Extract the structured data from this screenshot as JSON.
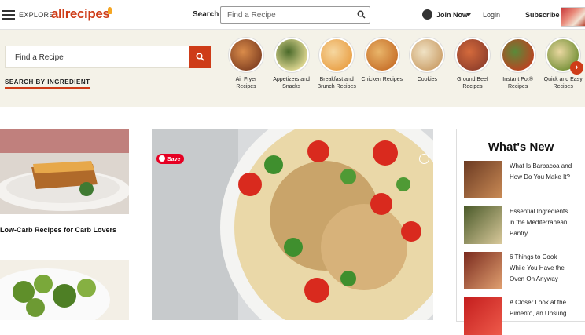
{
  "header": {
    "explore_label": "EXPLORE",
    "logo_text": "allrecipes",
    "search_label": "Search",
    "search_placeholder": "Find a Recipe",
    "join_label": "Join Now",
    "login_label": "Login",
    "subscribe_label": "Subscribe"
  },
  "band": {
    "find_placeholder": "Find a Recipe",
    "search_by_ingredient": "SEARCH BY INGREDIENT",
    "categories": [
      {
        "label": "Air Fryer Recipes",
        "color_a": "#7a3a1e",
        "color_b": "#d98b4a"
      },
      {
        "label": "Appetizers and Snacks",
        "color_a": "#f3e6a0",
        "color_b": "#4a6a2a"
      },
      {
        "label": "Breakfast and Brunch Recipes",
        "color_a": "#e89b3e",
        "color_b": "#f6d7a0"
      },
      {
        "label": "Chicken Recipes",
        "color_a": "#c46a24",
        "color_b": "#e9b56a"
      },
      {
        "label": "Cookies",
        "color_a": "#c89a62",
        "color_b": "#f0e2c4"
      },
      {
        "label": "Ground Beef Recipes",
        "color_a": "#8a3b2a",
        "color_b": "#d46a3c"
      },
      {
        "label": "Instant Pot® Recipes",
        "color_a": "#c73b1e",
        "color_b": "#5a8a3a"
      },
      {
        "label": "Quick and Easy Recipes",
        "color_a": "#6a8a2e",
        "color_b": "#e9d7a0"
      }
    ]
  },
  "main": {
    "card1_title": "Low-Carb Recipes for Carb Lovers",
    "save_label": "Save",
    "whats_new": {
      "title": "What's New",
      "items": [
        {
          "text": "What Is Barbacoa and How Do You Make It?",
          "color_a": "#6b3a22",
          "color_b": "#c98a55"
        },
        {
          "text": "Essential Ingredients in the Mediterranean Pantry",
          "color_a": "#4a5a2a",
          "color_b": "#d8c89a"
        },
        {
          "text": "6 Things to Cook While You Have the Oven On Anyway",
          "color_a": "#7a2a1e",
          "color_b": "#e0a070"
        },
        {
          "text": "A Closer Look at the Pimento, an Unsung",
          "color_a": "#c41e1e",
          "color_b": "#ee5a4a"
        }
      ]
    }
  }
}
